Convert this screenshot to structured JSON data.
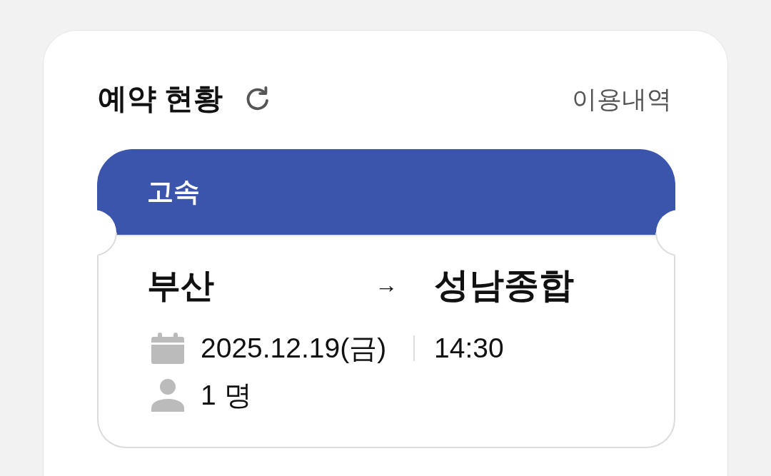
{
  "card": {
    "title": "예약 현황",
    "history_link": "이용내역"
  },
  "ticket": {
    "type_label": "고속",
    "origin": "부산",
    "arrow": "→",
    "destination": "성남종합",
    "date": "2025.12.19(금)",
    "time": "14:30",
    "passengers": "1 명"
  }
}
